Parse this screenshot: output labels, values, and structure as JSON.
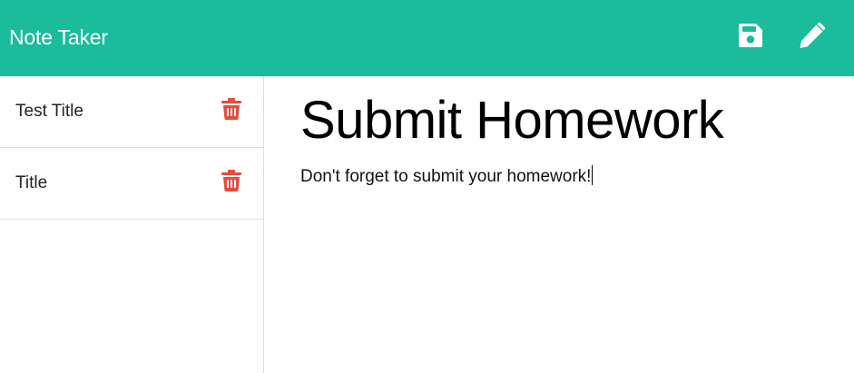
{
  "app": {
    "brand": "Note Taker",
    "accent_color": "#1abc9c",
    "delete_color": "#e74c3c"
  },
  "toolbar": {
    "save_icon": "floppy-disk-icon",
    "new_icon": "pencil-icon"
  },
  "notes": [
    {
      "title": "Test Title"
    },
    {
      "title": "Title"
    }
  ],
  "active_note": {
    "title": "Submit Homework",
    "text": "Don't forget to submit your homework!"
  }
}
